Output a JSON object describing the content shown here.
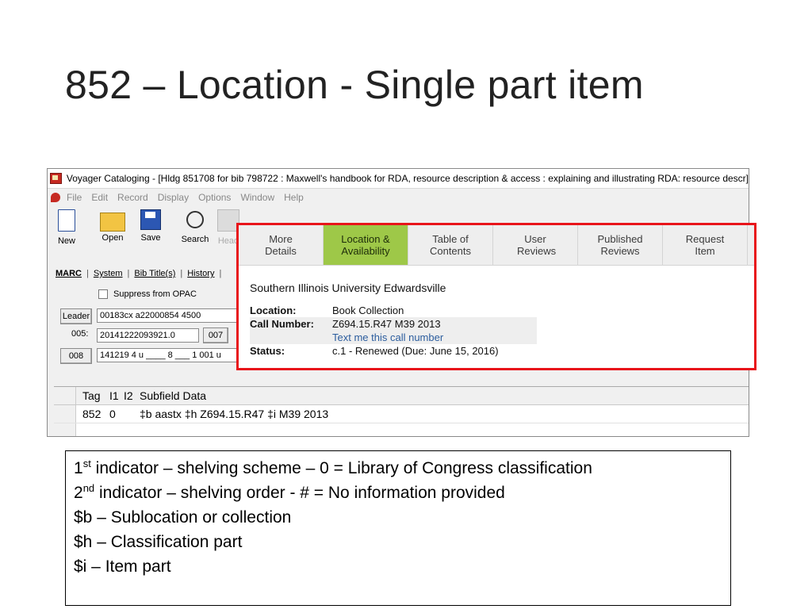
{
  "slide": {
    "title": "852 – Location - Single part item"
  },
  "window": {
    "title": "Voyager Cataloging - [Hldg 851708 for bib 798722 : Maxwell's handbook for RDA, resource description & access : explaining and illustrating RDA: resource descr]",
    "menu": [
      "File",
      "Edit",
      "Record",
      "Display",
      "Options",
      "Window",
      "Help"
    ],
    "toolbar": {
      "new": "New",
      "open": "Open",
      "save": "Save",
      "search": "Search",
      "head_partial": "Head"
    },
    "subtabs": [
      "MARC",
      "System",
      "Bib Title(s)",
      "History"
    ],
    "suppress_label": "Suppress from OPAC",
    "leader_label": "Leader",
    "leader_value": "00183cx  a22000854  4500",
    "f005_label": "005:",
    "f005_value": "20141222093921.0",
    "f007_label": "007",
    "f008_label": "008",
    "f008_value": "141219 4 u ____ 8 ___ 1 001 u"
  },
  "grid": {
    "headers": {
      "tag": "Tag",
      "i1": "I1",
      "i2": "I2",
      "sub": "Subfield Data"
    },
    "row": {
      "tag": "852",
      "i1": "0",
      "i2": "",
      "sub": "‡b aastx ‡h Z694.15.R47 ‡i M39 2013"
    }
  },
  "popup": {
    "tabs": [
      {
        "label": "More Details"
      },
      {
        "label": "Location & Availability"
      },
      {
        "label": "Table of Contents"
      },
      {
        "label": "User Reviews"
      },
      {
        "label": "Published Reviews"
      },
      {
        "label": "Request Item"
      }
    ],
    "institution": "Southern Illinois University Edwardsville",
    "location_label": "Location:",
    "location_value": "Book Collection",
    "callnumber_label": "Call Number:",
    "callnumber_value": "Z694.15.R47 M39 2013",
    "text_link": "Text me this call number",
    "status_label": "Status:",
    "status_value": "c.1 - Renewed (Due: June 15, 2016)"
  },
  "notes": {
    "line1_num": "1",
    "line1_sup": "st",
    "line1_rest": " indicator – shelving scheme – 0 = Library of Congress classification",
    "line2_num": "2",
    "line2_sup": "nd",
    "line2_rest": " indicator – shelving order - # = No information provided",
    "line3": "$b – Sublocation or collection",
    "line4": "$h – Classification part",
    "line5": "$i – Item part"
  },
  "colors": {
    "popup_border": "#e8141a",
    "active_tab": "#9ec848",
    "link": "#2c5d9e"
  }
}
